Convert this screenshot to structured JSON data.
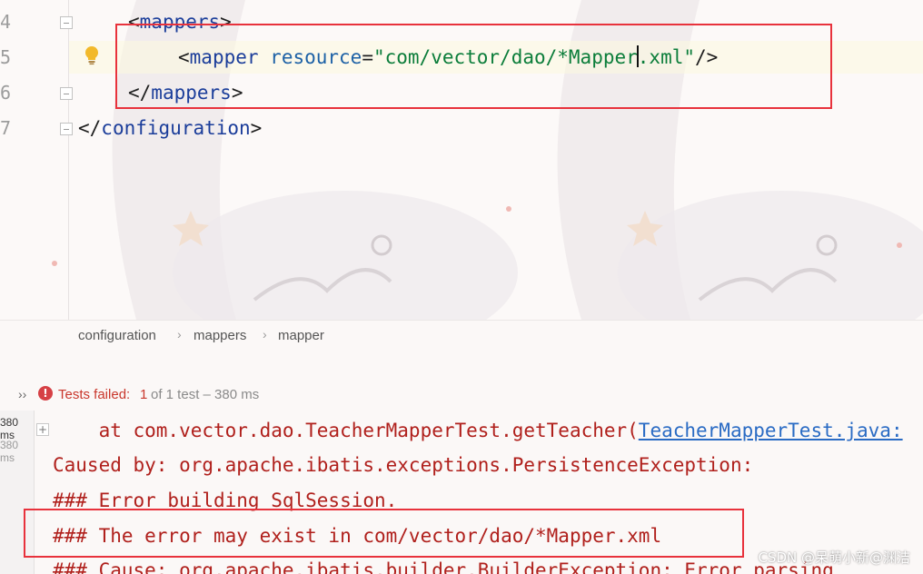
{
  "editor": {
    "line_numbers": [
      "4",
      "5",
      "6",
      "7"
    ],
    "lines": {
      "l4": {
        "open": "<",
        "tag": "mappers",
        "close": ">"
      },
      "l5": {
        "open": "<",
        "tag": "mapper",
        "attr": "resource",
        "eq": "=",
        "value_before_caret": "\"com/vector/dao/*Mapper",
        "value_after_caret": ".xml\"",
        "close": "/>"
      },
      "l6": {
        "open": "</",
        "tag": "mappers",
        "close": ">"
      },
      "l7": {
        "open": "</",
        "tag": "configuration",
        "close": ">"
      }
    }
  },
  "breadcrumb": {
    "items": [
      "configuration",
      "mappers",
      "mapper"
    ],
    "separator": "›"
  },
  "run_panel": {
    "expand_label": "››",
    "status": {
      "failed_label": "Tests failed:",
      "failed_count": "1",
      "rest": "of 1 test – 380 ms"
    },
    "durations": [
      "380 ms",
      "380 ms"
    ],
    "expand_button": "+",
    "console": {
      "line1_prefix": "    at com.vector.dao.TeacherMapperTest.getTeacher(",
      "line1_link": "TeacherMapperTest.java:",
      "line2": "Caused by: org.apache.ibatis.exceptions.PersistenceException:",
      "line3": "### Error building SqlSession.",
      "line4": "### The error may exist in com/vector/dao/*Mapper.xml",
      "line5": "### Cause: org.apache.ibatis.builder.BuilderException: Error parsing"
    }
  },
  "watermark": "CSDN @呆萌小新@渊洁",
  "colors": {
    "highlight_box": "#e8323c",
    "error_text": "#b0201c",
    "xml_tag": "#1b3d9a",
    "xml_value": "#0b7d3a",
    "link": "#2a6bc4"
  },
  "icons": {
    "bulb": "lightbulb-icon",
    "fold": "fold-icon",
    "error": "error-circle-icon"
  }
}
